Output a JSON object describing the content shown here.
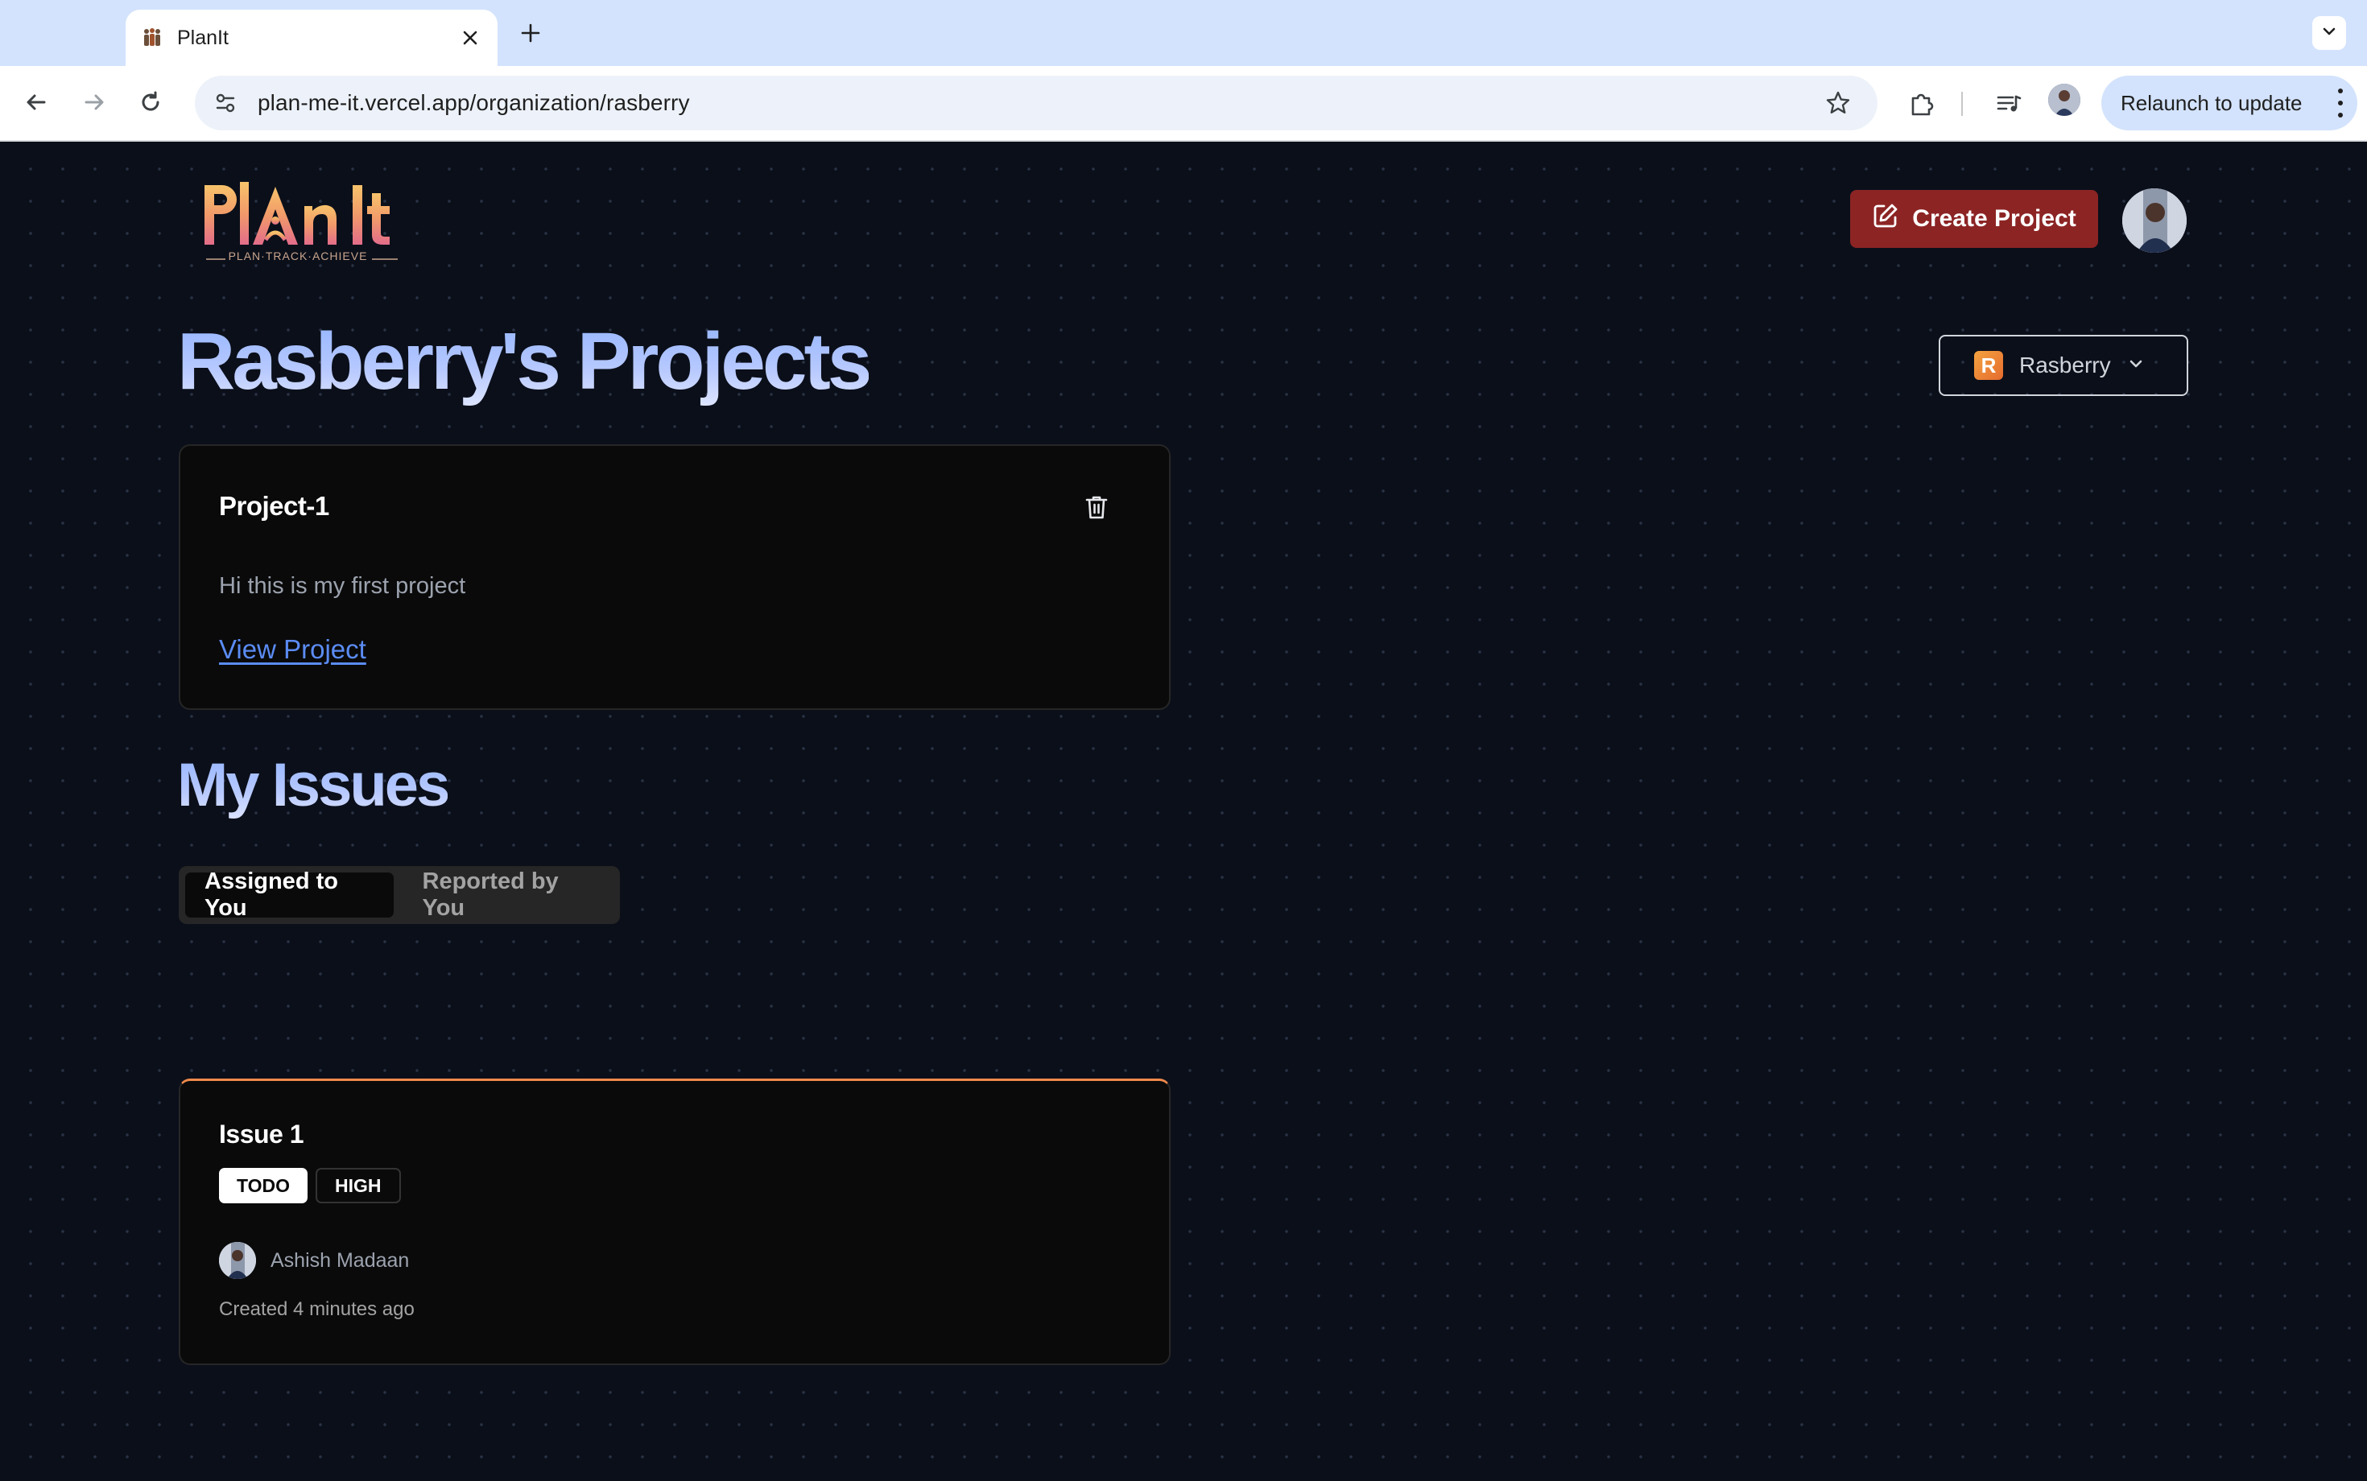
{
  "browser": {
    "tab_title": "PlanIt",
    "new_tab_symbol": "+",
    "url": "plan-me-it.vercel.app/organization/rasberry",
    "relaunch_label": "Relaunch to update"
  },
  "header": {
    "logo_text": "PlAn It",
    "logo_tagline": "PLAN·TRACK·ACHIEVE",
    "create_project_label": "Create Project"
  },
  "main": {
    "title": "Rasberry's Projects",
    "org_selector": {
      "badge_letter": "R",
      "selected": "Rasberry"
    },
    "projects": [
      {
        "name": "Project-1",
        "description": "Hi this is my first project",
        "link_label": "View Project"
      }
    ]
  },
  "issues": {
    "title": "My Issues",
    "tabs": [
      {
        "label": "Assigned to You",
        "active": true
      },
      {
        "label": "Reported by You",
        "active": false
      }
    ],
    "items": [
      {
        "title": "Issue 1",
        "status": "TODO",
        "priority": "HIGH",
        "assignee": "Ashish Madaan",
        "created": "Created 4 minutes ago"
      }
    ]
  },
  "colors": {
    "page_bg": "#0b0f1a",
    "accent_red": "#8c2424",
    "link_blue": "#5b8cf4",
    "issue_border": "#f08a4b",
    "title_gradient_start": "#93b4ff"
  },
  "icons": {
    "tab_favicon": "people-icon",
    "back": "arrow-left-icon",
    "forward": "arrow-right-icon",
    "reload": "reload-icon",
    "site_info": "tune-icon",
    "bookmark": "star-icon",
    "extensions": "puzzle-icon",
    "media": "media-queue-icon",
    "create_project": "edit-square-icon",
    "delete": "trash-icon",
    "dropdown": "chevron-down-icon"
  }
}
